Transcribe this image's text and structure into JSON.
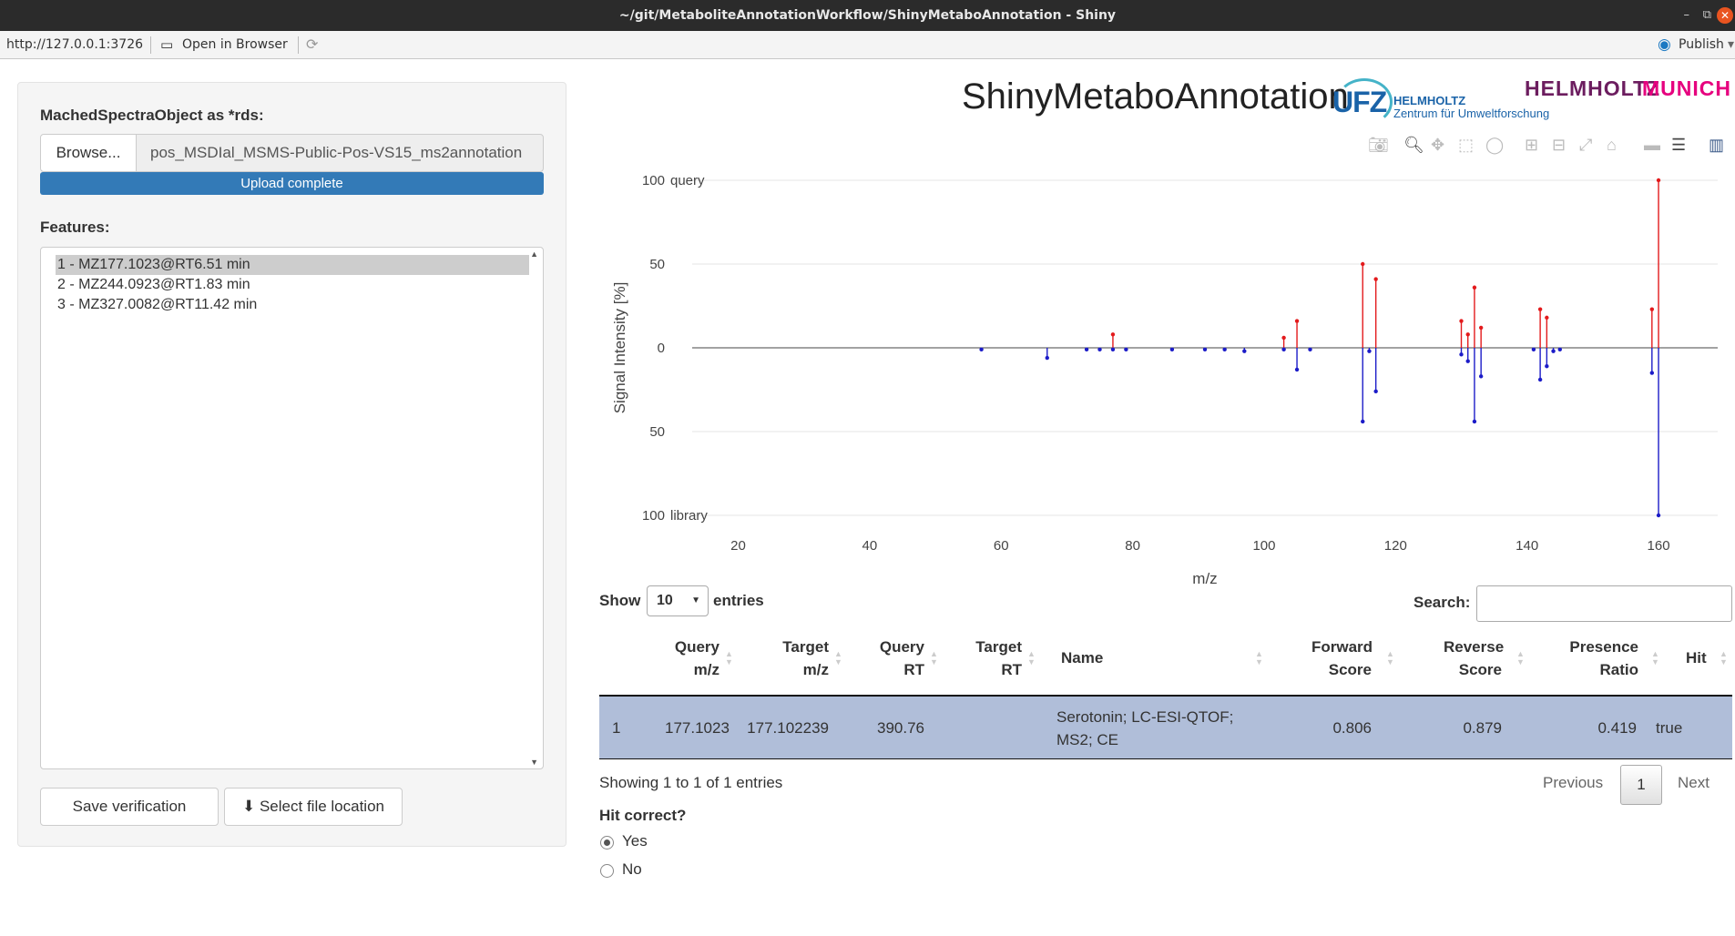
{
  "window": {
    "title": "~/git/MetaboliteAnnotationWorkflow/ShinyMetaboAnnotation - Shiny"
  },
  "addressbar": {
    "url": "http://127.0.0.1:3726",
    "open_browser": "Open in Browser",
    "publish": "Publish"
  },
  "left": {
    "upload_label": "MachedSpectraObject as *rds:",
    "browse_label": "Browse...",
    "file_name": "pos_MSDIal_MSMS-Public-Pos-VS15_ms2annotation",
    "progress_text": "Upload complete",
    "progress": 1.0,
    "features_label": "Features:",
    "features": [
      "1 - MZ177.1023@RT6.51 min",
      "2 - MZ244.0923@RT1.83 min",
      "3 - MZ327.0082@RT11.42 min"
    ],
    "selected_feature": 0,
    "save_button": "Save verification",
    "select_file_button": "Select file location"
  },
  "brand": {
    "app_title": "ShinyMetaboAnnotation",
    "ufz_logo": "UFZ",
    "ufz_line1": "HELMHOLTZ",
    "ufz_line2": "Zentrum für Umweltforschung",
    "hm_logo_a": "HELMHOLTZ",
    "hm_logo_b": "MUNICH"
  },
  "modebar_icons": [
    "camera-icon",
    "zoom-icon",
    "pan-icon",
    "box-select-icon",
    "lasso-icon",
    "zoom-in-icon",
    "zoom-out-icon",
    "autoscale-icon",
    "reset-axes-icon",
    "spike-lines-icon",
    "compare-hover-icon",
    "plotly-logo-icon"
  ],
  "chart_data": {
    "type": "bar",
    "subtype": "mirror-stick",
    "xlabel": "m/z",
    "ylabel": "Signal Intensity [%]",
    "xlim": [
      13,
      169
    ],
    "ylim": [
      -100,
      100
    ],
    "xticks": [
      20,
      40,
      60,
      80,
      100,
      120,
      140,
      160
    ],
    "yticks": [
      {
        "value": 100,
        "label": "100"
      },
      {
        "value": 50,
        "label": "50"
      },
      {
        "value": 0,
        "label": "0"
      },
      {
        "value": -50,
        "label": "50"
      },
      {
        "value": -100,
        "label": "100"
      }
    ],
    "annotations": [
      {
        "text": "query",
        "y": 100
      },
      {
        "text": "library",
        "y": -100
      }
    ],
    "series": [
      {
        "role": "query",
        "color": "#e31a1c",
        "x": [
          77,
          103,
          105,
          115,
          117,
          130,
          131,
          132,
          133,
          142,
          143,
          159,
          160
        ],
        "values": [
          8,
          6,
          16,
          50,
          41,
          16,
          8,
          36,
          12,
          23,
          18,
          23,
          100
        ]
      },
      {
        "role": "library",
        "color": "#1c1cc8",
        "x": [
          57,
          67,
          73,
          75,
          77,
          79,
          86,
          91,
          94,
          97,
          103,
          105,
          107,
          115,
          116,
          117,
          130,
          131,
          132,
          133,
          141,
          142,
          143,
          144,
          145,
          159,
          160
        ],
        "values": [
          -1,
          -6,
          -1,
          -1,
          -1,
          -1,
          -1,
          -1,
          -1,
          -2,
          -1,
          -13,
          -1,
          -44,
          -2,
          -26,
          -4,
          -8,
          -44,
          -17,
          -1,
          -19,
          -11,
          -2,
          -1,
          -15,
          -100
        ]
      }
    ]
  },
  "table": {
    "show_label": "Show",
    "entries_value": "10",
    "entries_label": "entries",
    "search_label": "Search:",
    "columns": [
      {
        "line1": "",
        "line2": ""
      },
      {
        "line1": "Query",
        "line2": "m/z"
      },
      {
        "line1": "Target",
        "line2": "m/z"
      },
      {
        "line1": "Query",
        "line2": "RT"
      },
      {
        "line1": "Target",
        "line2": "RT"
      },
      {
        "line1": "Name",
        "line2": ""
      },
      {
        "line1": "Forward",
        "line2": "Score"
      },
      {
        "line1": "Reverse",
        "line2": "Score"
      },
      {
        "line1": "Presence",
        "line2": "Ratio"
      },
      {
        "line1": "Hit",
        "line2": ""
      }
    ],
    "rows": [
      {
        "idx": "1",
        "query_mz": "177.1023",
        "target_mz": "177.102239",
        "query_rt": "390.76",
        "target_rt": "",
        "name_line1": "Serotonin; LC-ESI-QTOF;",
        "name_line2": "MS2; CE",
        "forward": "0.806",
        "reverse": "0.879",
        "presence": "0.419",
        "hit": "true"
      }
    ],
    "info": "Showing 1 to 1 of 1 entries",
    "previous": "Previous",
    "page": "1",
    "next": "Next"
  },
  "hit_question": {
    "label": "Hit correct?",
    "options": [
      "Yes",
      "No"
    ],
    "selected": "Yes"
  }
}
